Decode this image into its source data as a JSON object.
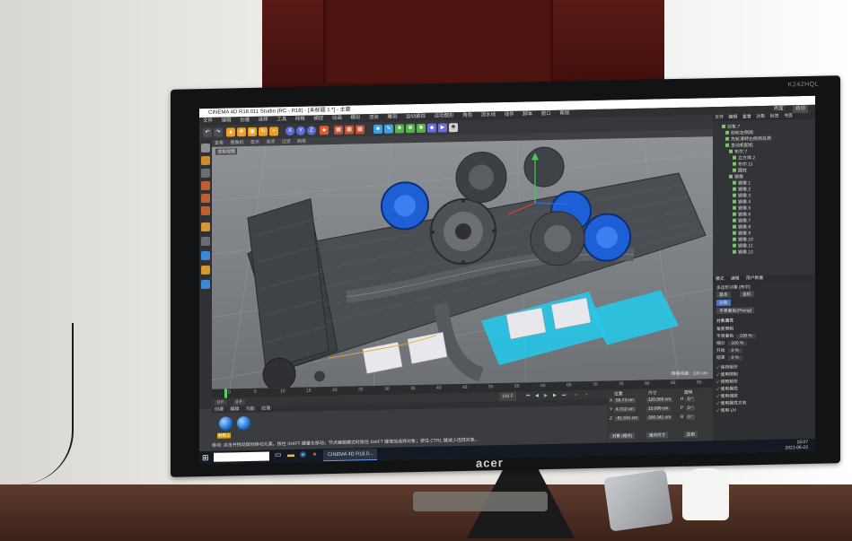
{
  "monitor": {
    "model": "K242HQL",
    "brand": "acer"
  },
  "app": {
    "title": "CINEMA 4D R18.011 Studio (RC - R18) - [未标题 1 *] - 主要",
    "menus": [
      "文件",
      "编辑",
      "创建",
      "选择",
      "工具",
      "网格",
      "捕捉",
      "动画",
      "模拟",
      "渲染",
      "雕刻",
      "运动跟踪",
      "运动图形",
      "角色",
      "流水线",
      "插件",
      "脚本",
      "窗口",
      "帮助"
    ],
    "layout_label": "界面:",
    "layout_value": "启动"
  },
  "viewport": {
    "menus": [
      "查看",
      "摄像机",
      "显示",
      "选项",
      "过滤",
      "面板"
    ],
    "label": "透视视图",
    "grid_distance": "网格间距 : 100 cm"
  },
  "timeline": {
    "ticks": [
      "0",
      "5",
      "10",
      "15",
      "20",
      "25",
      "30",
      "35",
      "40",
      "45",
      "50",
      "55",
      "60",
      "65",
      "70",
      "75",
      "80",
      "85",
      "90"
    ],
    "current": "0 F",
    "start": "0 F",
    "end": "100 F"
  },
  "materials": {
    "menus": [
      "创建",
      "编辑",
      "功能",
      "纹理"
    ],
    "items": [
      {
        "label": "材质.1"
      },
      {
        "label": ""
      }
    ]
  },
  "status": "移动: 点击并拖动鼠标移动元素。按住 SHIFT 键量化移动；节点编辑模式时按住 SHIFT 键增加选择对象；按住 CTRL 键减少选择对象。",
  "coordinates": {
    "headers": [
      "位置",
      "尺寸",
      "旋转"
    ],
    "rows": [
      {
        "axis": "X",
        "pos": "55.73 cm",
        "size": "120.565 cm",
        "rot": "H",
        "rotv": "0 °"
      },
      {
        "axis": "Y",
        "pos": "4.712 cm",
        "size": "15.099 cm",
        "rot": "P",
        "rotv": "0 °"
      },
      {
        "axis": "Z",
        "pos": "-91.531 cm",
        "size": "206.341 cm",
        "rot": "B",
        "rotv": "0 °"
      }
    ],
    "mode": "对象 (相对)",
    "size_mode": "绝对尺寸",
    "apply": "应用"
  },
  "objects": {
    "menus": [
      "文件",
      "编辑",
      "查看",
      "对象",
      "标签",
      "书签"
    ],
    "items": [
      "对象.7",
      "前轮左侧周",
      "先轮滑转右侧周总周",
      "发动机配机",
      "布尔.7",
      "立方体.2",
      "布尔.11",
      "圆柱",
      "镜像",
      "镜像.1",
      "镜像.2",
      "镜像.3",
      "镜像.4",
      "镜像.5",
      "镜像.6",
      "镜像.7",
      "镜像.8",
      "镜像.9",
      "镜像.10",
      "镜像.11",
      "镜像.12"
    ]
  },
  "attributes": {
    "menus": [
      "模式",
      "编辑",
      "用户数据"
    ],
    "object_label": "多边形对象 [布尔]",
    "tabs": [
      "基本",
      "坐标",
      "对象",
      "平滑着色(Phong)"
    ],
    "section": "对象属性",
    "fields": [
      {
        "label": "角度限制",
        "value": ""
      },
      {
        "label": "平滑着色",
        "value": "100 %"
      },
      {
        "label": "细分",
        "value": "100 %"
      },
      {
        "label": "开始",
        "value": "0 %"
      },
      {
        "label": "结束",
        "value": "0 %"
      }
    ],
    "checkboxes": [
      "保持矩形",
      "使用限制",
      "按照矩形",
      "使用属性",
      "使用缩放",
      "使用属性方向",
      "使用 UV"
    ]
  },
  "taskbar": {
    "search_placeholder": "",
    "app_label": "CINEMA 4D R18.0...",
    "time": "15:07",
    "date": "2021-06-22"
  },
  "colors": {
    "turbo_blue": "#1f5fd6",
    "coolant_cyan": "#27c7e8",
    "accent_orange": "#f0a020",
    "taskbar": "#141a24"
  }
}
